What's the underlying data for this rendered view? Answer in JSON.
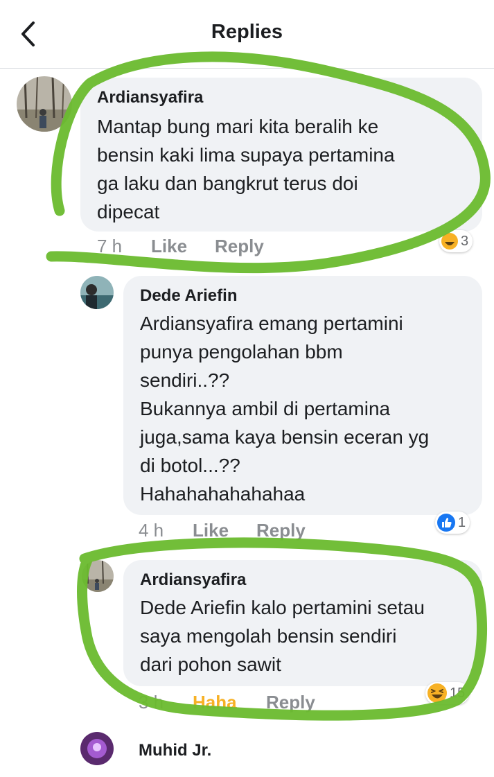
{
  "header": {
    "title": "Replies"
  },
  "comments": [
    {
      "author": "Ardiansyafira",
      "text": "Mantap bung mari kita beralih ke\nbensin kaki lima supaya pertamina\nga laku dan bangkrut terus doi\ndipecat",
      "time": "7 h",
      "like_label": "Like",
      "reply_label": "Reply",
      "reaction_count": "3"
    },
    {
      "author": "Dede Ariefin",
      "text": "Ardiansyafira emang pertamini\npunya pengolahan bbm\nsendiri..??\nBukannya ambil di pertamina\njuga,sama kaya bensin eceran yg\ndi botol...??\nHahahahahahahaa",
      "time": "4 h",
      "like_label": "Like",
      "reply_label": "Reply",
      "reaction_count": "1"
    },
    {
      "author": "Ardiansyafira",
      "text": "Dede Ariefin kalo pertamini setau\nsaya mengolah bensin sendiri\ndari pohon sawit",
      "time": "3 h",
      "like_label": "Haha",
      "reply_label": "Reply",
      "reaction_count": "15"
    },
    {
      "author": "Muhid Jr."
    }
  ],
  "colors": {
    "marker_green": "#6aba2e",
    "haha_orange": "#f7b125",
    "like_blue": "#1877f2",
    "meta_gray": "#8a8d91"
  },
  "icons": {
    "back": "chevron-left-icon",
    "like_reaction": "thumbs-up-icon",
    "haha_reaction": "laughing-face-icon"
  }
}
